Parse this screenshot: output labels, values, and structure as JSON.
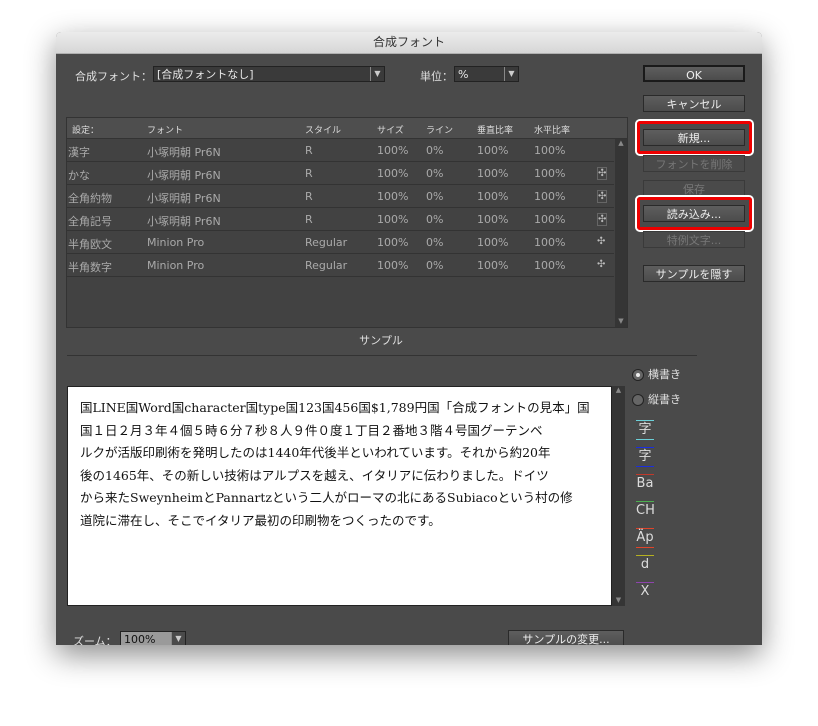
{
  "window": {
    "title": "合成フォント"
  },
  "composite": {
    "label": "合成フォント：",
    "value": "[合成フォントなし]"
  },
  "unit": {
    "label": "単位：",
    "value": "%"
  },
  "table": {
    "headers": [
      "設定：",
      "フォント",
      "スタイル",
      "サイズ",
      "ライン",
      "垂直比率",
      "水平比率"
    ],
    "rows": [
      [
        "漢字",
        "小塚明朝 Pr6N",
        "R",
        "100%",
        "0%",
        "100%",
        "100%"
      ],
      [
        "かな",
        "小塚明朝 Pr6N",
        "R",
        "100%",
        "0%",
        "100%",
        "100%"
      ],
      [
        "全角約物",
        "小塚明朝 Pr6N",
        "R",
        "100%",
        "0%",
        "100%",
        "100%"
      ],
      [
        "全角記号",
        "小塚明朝 Pr6N",
        "R",
        "100%",
        "0%",
        "100%",
        "100%"
      ],
      [
        "半角欧文",
        "Minion Pro",
        "Regular",
        "100%",
        "0%",
        "100%",
        "100%"
      ],
      [
        "半角数字",
        "Minion Pro",
        "Regular",
        "100%",
        "0%",
        "100%",
        "100%"
      ]
    ]
  },
  "buttons": {
    "ok": "OK",
    "cancel": "キャンセル",
    "new": "新規...",
    "delete": "フォントを削除",
    "save": "保存",
    "load": "読み込み...",
    "exception": "特例文字...",
    "hide_sample": "サンプルを隠す",
    "change_sample": "サンプルの変更..."
  },
  "sample": {
    "title": "サンプル",
    "lines": [
      "国LINE国Word国character国type国123国456国$1,789円国「合成フォントの見本」国",
      "国１日２月３年４個５時６分７秒８人９件０度１丁目２番地３階４号国グーテンベ",
      "ルクが活版印刷術を発明したのは1440年代後半といわれています。それから約20年",
      "後の1465年、その新しい技術はアルプスを越え、イタリアに伝わりました。ドイツ",
      "から来たSweynheimとPannartzという二人がローマの北にあるSubiacoという村の修",
      "道院に滞在し、そこでイタリア最初の印刷物をつくったのです。"
    ]
  },
  "orientation": {
    "horizontal": "横書き",
    "vertical": "縦書き"
  },
  "guides": [
    {
      "glyph": "字",
      "color": "#6cd0d8"
    },
    {
      "glyph": "字",
      "color": "#1a2ee0"
    },
    {
      "glyph": "Ba",
      "color": "#c0392b"
    },
    {
      "glyph": "CH",
      "color": "#4caf50"
    },
    {
      "glyph": "Äp",
      "color": "#e0442a"
    },
    {
      "glyph": "d",
      "color": "#b5b020"
    },
    {
      "glyph": "X",
      "color": "#8e44ad"
    }
  ],
  "zoom": {
    "label": "ズーム：",
    "value": "100%"
  }
}
